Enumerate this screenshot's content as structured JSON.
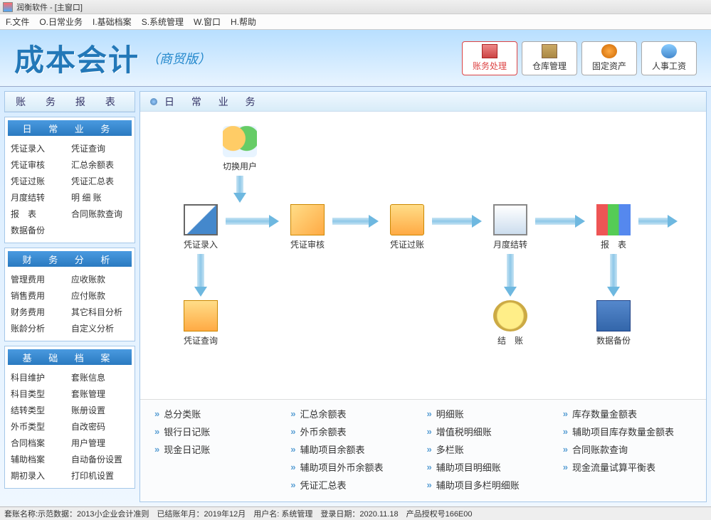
{
  "window": {
    "title": "润衡软件 - [主窗口]"
  },
  "menu": [
    "F.文件",
    "O.日常业务",
    "I.基础档案",
    "S.系统管理",
    "W.窗口",
    "H.帮助"
  ],
  "banner": {
    "logo": "成本会计",
    "sublogo": "（商贸版）",
    "tabs": [
      {
        "label": "账务处理",
        "active": true
      },
      {
        "label": "仓库管理",
        "active": false
      },
      {
        "label": "固定资产",
        "active": false
      },
      {
        "label": "人事工资",
        "active": false
      }
    ]
  },
  "sidebar": {
    "panel_title": "账 务 报 表",
    "sections": [
      {
        "title": "日 常 业 务",
        "links": [
          "凭证录入",
          "凭证查询",
          "凭证审核",
          "汇总余额表",
          "凭证过账",
          "凭证汇总表",
          "月度结转",
          "明 细 账",
          "报　表",
          "合同账款查询",
          "数据备份"
        ]
      },
      {
        "title": "财 务 分 析",
        "links": [
          "管理费用",
          "应收账款",
          "销售费用",
          "应付账款",
          "财务费用",
          "其它科目分析",
          "账龄分析",
          "自定义分析"
        ]
      },
      {
        "title": "基 础 档 案",
        "links": [
          "科目维护",
          "套账信息",
          "科目类型",
          "套账管理",
          "结转类型",
          "账册设置",
          "外币类型",
          "自改密码",
          "合同档案",
          "用户管理",
          "辅助档案",
          "自动备份设置",
          "期初录入",
          "打印机设置"
        ]
      }
    ]
  },
  "main": {
    "title": "日 常 业 务",
    "nodes": {
      "switch_user": "切换用户",
      "entry": "凭证录入",
      "audit": "凭证审核",
      "post": "凭证过账",
      "month_end": "月度结转",
      "report": "报　表",
      "query": "凭证查询",
      "settle": "结　账",
      "backup": "数据备份"
    },
    "biglinks_cols": [
      [
        "总分类账",
        "银行日记账",
        "现金日记账"
      ],
      [
        "汇总余额表",
        "外币余额表",
        "辅助项目余额表",
        "辅助项目外币余额表",
        "凭证汇总表"
      ],
      [
        "明细账",
        "增值税明细账",
        "多栏账",
        "辅助项目明细账",
        "辅助项目多栏明细账"
      ],
      [
        "库存数量金额表",
        "辅助项目库存数量金额表",
        "合同账款查询",
        "现金流量试算平衡表"
      ]
    ]
  },
  "status": "套账名称:示范数据：2013小企业会计准则　已结账年月：2019年12月　用户名: 系统管理　登录日期：2020.11.18　产品授权号166E00"
}
